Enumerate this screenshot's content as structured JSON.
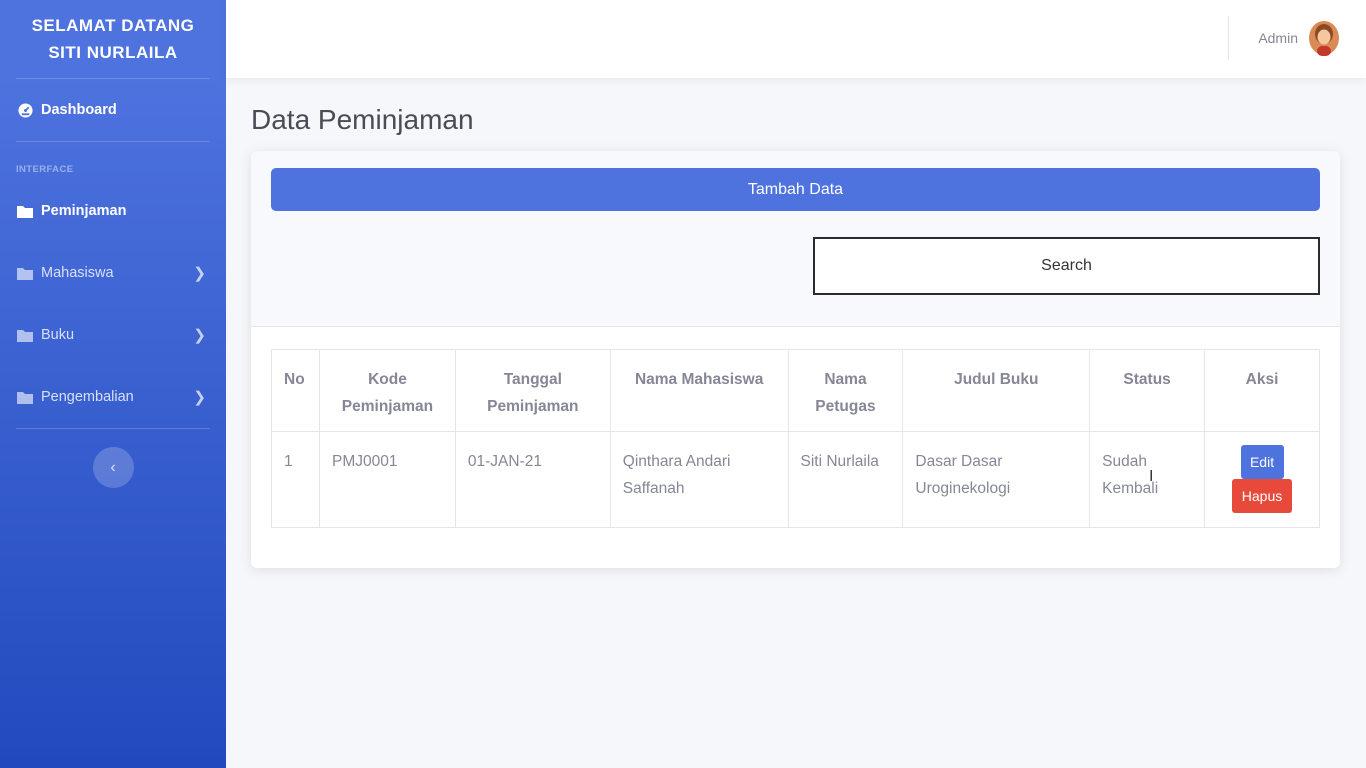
{
  "sidebar": {
    "brand_line1": "SELAMAT DATANG",
    "brand_line2": "SITI NURLAILA",
    "dashboard_label": "Dashboard",
    "heading": "INTERFACE",
    "items": [
      {
        "label": "Peminjaman",
        "icon": "folder-icon"
      },
      {
        "label": "Mahasiswa",
        "icon": "folder-icon"
      },
      {
        "label": "Buku",
        "icon": "folder-icon"
      },
      {
        "label": "Pengembalian",
        "icon": "folder-icon"
      }
    ],
    "toggle_glyph": "‹"
  },
  "topbar": {
    "user_name": "Admin"
  },
  "main": {
    "title": "Data Peminjaman",
    "add_button": "Tambah Data",
    "search_placeholder": "Search",
    "table": {
      "headers": [
        "No",
        "Kode Peminjaman",
        "Tanggal Peminjaman",
        "Nama Mahasiswa",
        "Nama Petugas",
        "Judul Buku",
        "Status",
        "Aksi"
      ],
      "rows": [
        {
          "no": "1",
          "kode": "PMJ0001",
          "tanggal": "01-JAN-21",
          "nama_mahasiswa": "Qinthara Andari Saffanah",
          "nama_petugas": "Siti Nurlaila",
          "judul": "Dasar Dasar Uroginekologi",
          "status": "Sudah Kembali",
          "edit_label": "Edit",
          "delete_label": "Hapus"
        }
      ]
    }
  },
  "colors": {
    "primary": "#4e73df",
    "danger": "#e74a3b",
    "sidebar_bottom": "#224abe"
  }
}
